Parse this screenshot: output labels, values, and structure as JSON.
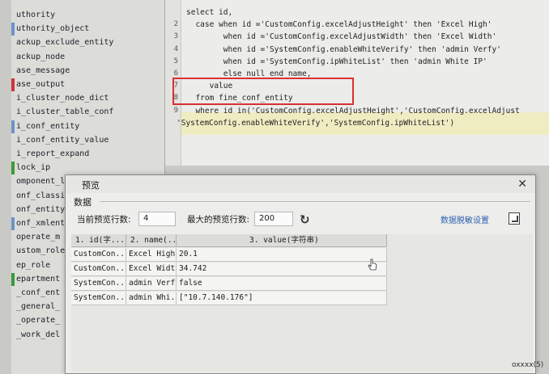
{
  "tables": [
    {
      "name": "uthority",
      "mark": ""
    },
    {
      "name": "uthority_object",
      "mark": "#6b93c8"
    },
    {
      "name": "ackup_exclude_entity",
      "mark": ""
    },
    {
      "name": "ackup_node",
      "mark": ""
    },
    {
      "name": "ase_message",
      "mark": ""
    },
    {
      "name": "ase_output",
      "mark": "#d0343a"
    },
    {
      "name": "i_cluster_node_dict",
      "mark": ""
    },
    {
      "name": "i_cluster_table_conf",
      "mark": ""
    },
    {
      "name": "i_conf_entity",
      "mark": "#6b93c8"
    },
    {
      "name": "i_conf_entity_value",
      "mark": ""
    },
    {
      "name": "i_report_expand",
      "mark": ""
    },
    {
      "name": "lock_ip",
      "mark": "#3a9a3a"
    },
    {
      "name": "omponent_l",
      "mark": ""
    },
    {
      "name": "onf_classi",
      "mark": ""
    },
    {
      "name": "onf_entity",
      "mark": ""
    },
    {
      "name": "onf_xmlent",
      "mark": "#6b93c8"
    },
    {
      "name": "operate_m",
      "mark": ""
    },
    {
      "name": "ustom_role",
      "mark": ""
    },
    {
      "name": "ep_role",
      "mark": ""
    },
    {
      "name": "epartment",
      "mark": "#3a9a3a"
    },
    {
      "name": "_conf_ent",
      "mark": ""
    },
    {
      "name": "_general_",
      "mark": ""
    },
    {
      "name": "_operate_",
      "mark": ""
    },
    {
      "name": "_work_del",
      "mark": ""
    }
  ],
  "editor": {
    "lines": [
      {
        "num": "",
        "text": "select id,"
      },
      {
        "num": "2",
        "text": "  case when id ='CustomConfig.excelAdjustHeight' then 'Excel High'"
      },
      {
        "num": "3",
        "text": "        when id ='CustomConfig.excelAdjustWidth' then 'Excel Width'"
      },
      {
        "num": "4",
        "text": "        when id ='SystemConfig.enableWhiteVerify' then 'admin Verfy'"
      },
      {
        "num": "5",
        "text": "        when id ='SystemConfig.ipWhiteList' then 'admin White IP'"
      },
      {
        "num": "6",
        "text": "        else null end name,"
      },
      {
        "num": "7",
        "text": "     value"
      },
      {
        "num": "8",
        "text": "  from fine_conf_entity"
      },
      {
        "num": "9",
        "text": "  where id in('CustomConfig.excelAdjustHeight','CustomConfig.excelAdjust"
      },
      {
        "num": "",
        "text": "'SystemConfig.enableWhiteVerify','SystemConfig.ipWhiteList')"
      }
    ]
  },
  "dialog": {
    "title": "预览",
    "group": "数据",
    "current_rows_label": "当前预览行数:",
    "current_rows_value": "4",
    "max_rows_label": "最大的预览行数:",
    "max_rows_value": "200",
    "desensitize_label": "数据脱敏设置",
    "columns": [
      "1. id(字...",
      "2. name(...",
      "3. value(字符串)"
    ],
    "rows": [
      [
        "CustomCon...",
        "Excel High",
        "20.1"
      ],
      [
        "CustomCon...",
        "Excel Width",
        "34.742"
      ],
      [
        "SystemCon...",
        "admin Verfy",
        "false"
      ],
      [
        "SystemCon...",
        "admin Whi...",
        "[\"10.7.140.176\"]"
      ]
    ]
  },
  "corner_text": "oxxxx(5)",
  "colors": {
    "highlight_box": "#d93030",
    "selection_band": "#f0ecc2"
  }
}
